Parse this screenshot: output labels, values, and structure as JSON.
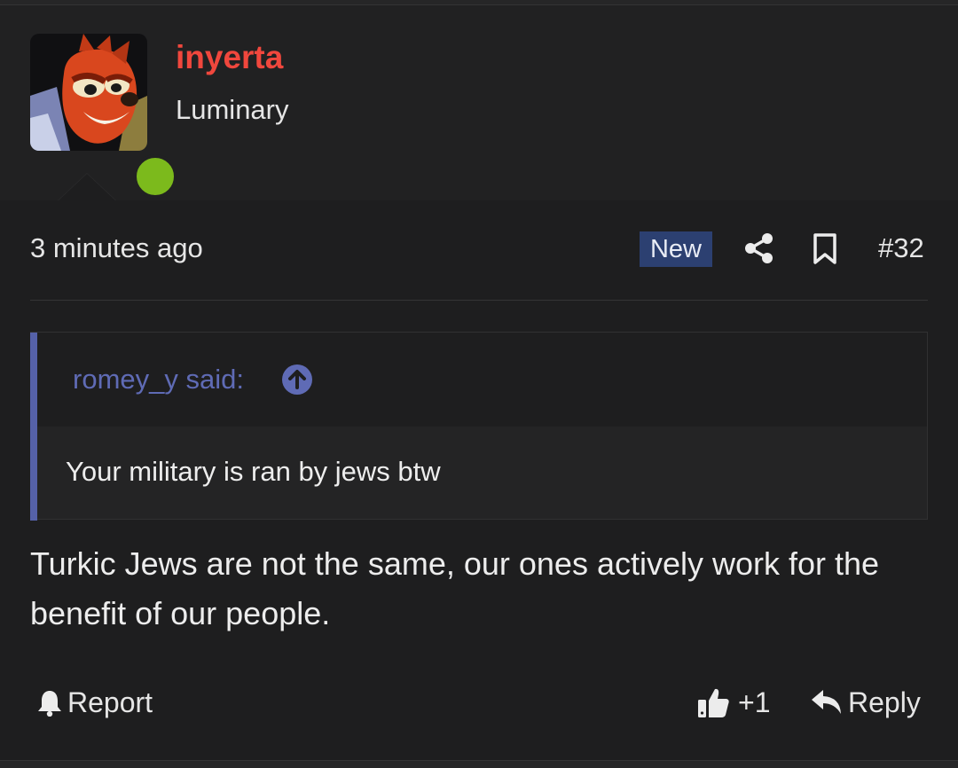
{
  "post": {
    "username": "inyerta",
    "user_title": "Luminary",
    "timestamp": "3 minutes ago",
    "badge": "New",
    "post_number": "#32",
    "quote": {
      "author": "romey_y said:",
      "text": "Your military is ran by jews btw"
    },
    "body": "Turkic Jews are not the same, our ones actively work for the benefit of our people.",
    "actions": {
      "report": "Report",
      "like": "+1",
      "reply": "Reply"
    }
  },
  "icons": {
    "share": "share-icon",
    "bookmark": "bookmark-icon",
    "goto": "arrow-up-circle-icon",
    "report": "bell-icon",
    "like": "thumbs-up-icon",
    "reply": "reply-icon"
  },
  "colors": {
    "username": "#f0473d",
    "badge_bg": "#2c4071",
    "quote_accent": "#5561a8",
    "quote_author": "#5f6bb5",
    "online": "#7cba1c"
  }
}
